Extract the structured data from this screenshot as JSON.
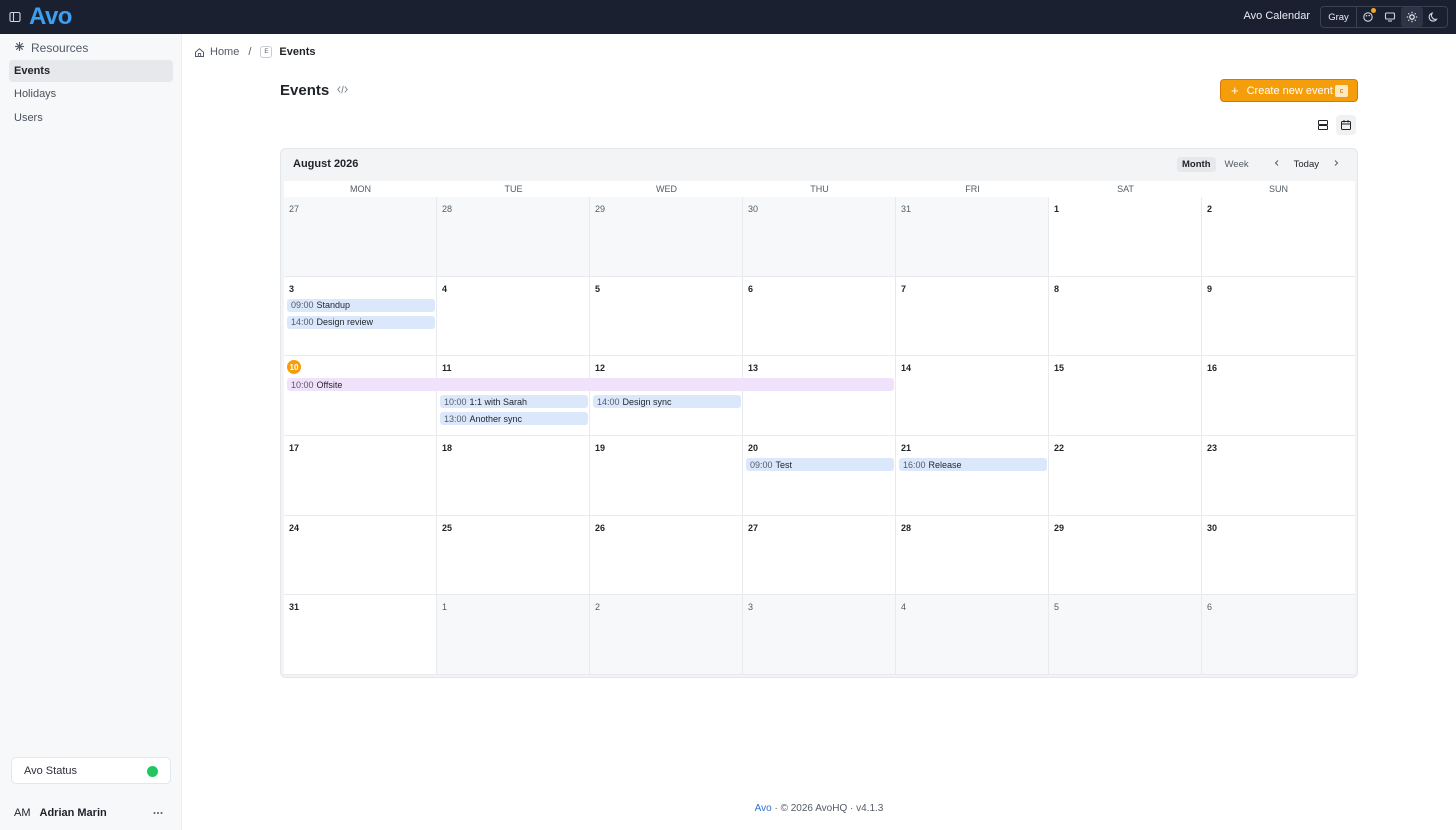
{
  "topbar": {
    "logo": "Avo",
    "app_name": "Avo Calendar",
    "theme_label": "Gray"
  },
  "sidebar": {
    "section_title": "Resources",
    "items": [
      {
        "label": "Events",
        "active": true
      },
      {
        "label": "Holidays",
        "active": false
      },
      {
        "label": "Users",
        "active": false
      }
    ],
    "status_label": "Avo Status",
    "status_color": "#22c55e",
    "user": {
      "initials": "AM",
      "name": "Adrian Marin"
    }
  },
  "breadcrumb": {
    "home": "Home",
    "separator": "/",
    "resource_badge": "E",
    "current": "Events"
  },
  "page": {
    "title": "Events",
    "create_button": "Create new event",
    "create_shortcut": "c",
    "accent": "#f59e0b"
  },
  "calendar": {
    "title": "August 2026",
    "view_month": "Month",
    "view_week": "Week",
    "today_label": "Today",
    "weekdays": [
      "MON",
      "TUE",
      "WED",
      "THU",
      "FRI",
      "SAT",
      "SUN"
    ],
    "days": [
      {
        "n": "27",
        "out": true
      },
      {
        "n": "28",
        "out": true
      },
      {
        "n": "29",
        "out": true
      },
      {
        "n": "30",
        "out": true
      },
      {
        "n": "31",
        "out": true
      },
      {
        "n": "1"
      },
      {
        "n": "2"
      },
      {
        "n": "3"
      },
      {
        "n": "4"
      },
      {
        "n": "5"
      },
      {
        "n": "6"
      },
      {
        "n": "7"
      },
      {
        "n": "8"
      },
      {
        "n": "9"
      },
      {
        "n": "10",
        "today": true
      },
      {
        "n": "11"
      },
      {
        "n": "12"
      },
      {
        "n": "13"
      },
      {
        "n": "14"
      },
      {
        "n": "15"
      },
      {
        "n": "16"
      },
      {
        "n": "17"
      },
      {
        "n": "18"
      },
      {
        "n": "19"
      },
      {
        "n": "20"
      },
      {
        "n": "21"
      },
      {
        "n": "22"
      },
      {
        "n": "23"
      },
      {
        "n": "24"
      },
      {
        "n": "25"
      },
      {
        "n": "26"
      },
      {
        "n": "27"
      },
      {
        "n": "28"
      },
      {
        "n": "29"
      },
      {
        "n": "30"
      },
      {
        "n": "31"
      },
      {
        "n": "1",
        "out": true
      },
      {
        "n": "2",
        "out": true
      },
      {
        "n": "3",
        "out": true
      },
      {
        "n": "4",
        "out": true
      },
      {
        "n": "5",
        "out": true
      },
      {
        "n": "6",
        "out": true
      }
    ],
    "events": [
      {
        "time": "09:00",
        "title": "Standup",
        "week": 1,
        "day": 0,
        "span": 1,
        "slot": 0,
        "color": "blue"
      },
      {
        "time": "14:00",
        "title": "Design review",
        "week": 1,
        "day": 0,
        "span": 1,
        "slot": 1,
        "color": "blue"
      },
      {
        "time": "10:00",
        "title": "Offsite",
        "week": 2,
        "day": 0,
        "span": 4,
        "slot": 0,
        "color": "purple"
      },
      {
        "time": "10:00",
        "title": "1:1 with Sarah",
        "week": 2,
        "day": 1,
        "span": 1,
        "slot": 1,
        "color": "blue"
      },
      {
        "time": "13:00",
        "title": "Another sync",
        "week": 2,
        "day": 1,
        "span": 1,
        "slot": 2,
        "color": "blue"
      },
      {
        "time": "14:00",
        "title": "Design sync",
        "week": 2,
        "day": 2,
        "span": 1,
        "slot": 1,
        "color": "blue"
      },
      {
        "time": "09:00",
        "title": "Test",
        "week": 3,
        "day": 3,
        "span": 1,
        "slot": 0,
        "color": "blue"
      },
      {
        "time": "16:00",
        "title": "Release",
        "week": 3,
        "day": 4,
        "span": 1,
        "slot": 0,
        "color": "blue"
      }
    ]
  },
  "footer": {
    "link": "Avo",
    "rest": " · © 2026 AvoHQ · v4.1.3"
  }
}
